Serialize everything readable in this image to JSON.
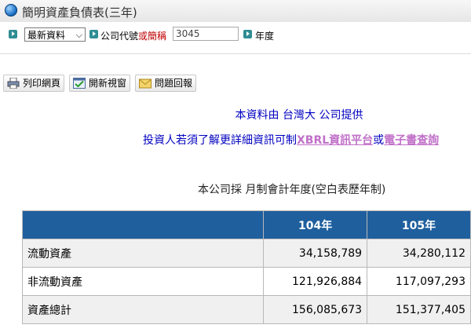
{
  "header": {
    "title": "簡明資產負債表(三年)"
  },
  "query": {
    "period_selected": "最新資料",
    "company_label_a": "公司代號",
    "company_label_or": "或簡稱",
    "company_code": "3045",
    "year_label": "年度"
  },
  "toolbar": {
    "print_label": "列印網頁",
    "new_window_label": "開新視窗",
    "feedback_label": "問題回報"
  },
  "notice": {
    "provider": "本資料由 台灣大 公司提供",
    "info_prefix": "投資人若須了解更詳細資訊可制",
    "xbrl_link": "XBRL資訊平台",
    "or_text": "或",
    "ebook_link": "電子書查詢",
    "basis": "本公司採  月制會計年度(空白表歷年制)"
  },
  "table": {
    "columns": [
      "",
      "104年",
      "105年"
    ],
    "rows": [
      {
        "item": "流動資產",
        "v104": "34,158,789",
        "v105": "34,280,112"
      },
      {
        "item": "非流動資產",
        "v104": "121,926,884",
        "v105": "117,097,293"
      },
      {
        "item": "資產總計",
        "v104": "156,085,673",
        "v105": "151,377,405"
      }
    ]
  },
  "colors": {
    "header_blue": "#1f5f9e",
    "notice_blue": "#0000c0",
    "link_purple": "#c070c8",
    "code_red": "#c00000"
  }
}
